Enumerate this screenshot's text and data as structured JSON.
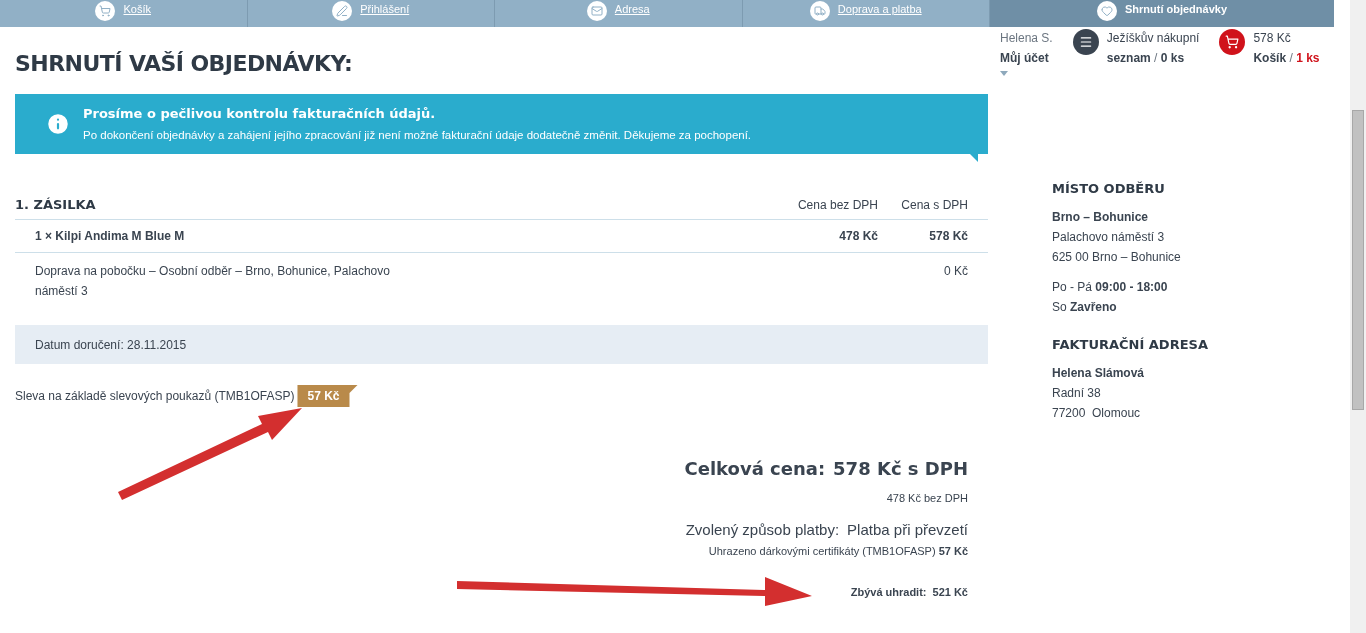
{
  "steps": [
    {
      "label": "Košík",
      "selected": false
    },
    {
      "label": "Přihlášení",
      "selected": false
    },
    {
      "label": "Adresa",
      "selected": false
    },
    {
      "label": "Doprava a platba",
      "selected": false
    },
    {
      "label": "Shrnutí objednávky",
      "selected": true
    }
  ],
  "user": {
    "name": "Helena S.",
    "account": "Můj účet"
  },
  "wishlist": {
    "line1": "Ježíškův nákupní",
    "label": "seznam",
    "separator": "/",
    "count": "0 ks"
  },
  "cart": {
    "price": "578 Kč",
    "label": "Košík",
    "separator": "/",
    "count": "1 ks"
  },
  "title": "SHRNUTÍ VAŠÍ OBJEDNÁVKY:",
  "notice": {
    "heading": "Prosíme o pečlivou kontrolu fakturačních údajů.",
    "text": "Po dokončení objednávky a zahájení jejího zpracování již není možné fakturační údaje dodatečně změnit. Děkujeme za pochopení."
  },
  "shipment": {
    "title": "1. ZÁSILKA",
    "columns": [
      "Cena bez DPH",
      "Cena s DPH"
    ],
    "rows": [
      {
        "kind": "product",
        "label": "1 × Kilpi Andima M Blue M",
        "price_net": "478 Kč",
        "price_gross": "578 Kč"
      },
      {
        "kind": "shipping",
        "label": "Doprava na pobočku – Osobní odběr – Brno, Bohunice, Palachovo náměstí 3",
        "price_gross": "0 Kč"
      }
    ],
    "delivery_date": "Datum doručení: 28.11.2015"
  },
  "discount": {
    "label": "Sleva na základě slevových poukazů (TMB1OFASP)",
    "amount": "57 Kč"
  },
  "totals": {
    "total_label": "Celková cena:",
    "total": "578 Kč s DPH",
    "net": "478 Kč bez DPH",
    "payment_label": "Zvolený způsob platby:",
    "payment": "Platba při převzetí",
    "certificates": "Uhrazeno dárkovými certifikáty (TMB1OFASP) **57 Kč**",
    "remaining_label": "Zbývá uhradit:",
    "remaining": "521 Kč"
  },
  "pickup": {
    "title": "MÍSTO ODBĚRU",
    "name": "Brno – Bohunice",
    "lines": [
      "Palachovo náměstí 3",
      "625 00 Brno – Bohunice"
    ],
    "hours": [
      "Po - Pá **09:00 - 18:00**",
      "So **Zavřeno**"
    ]
  },
  "billing": {
    "title": "FAKTURAČNÍ ADRESA",
    "name": "Helena Slámová",
    "lines": [
      "Radní 38",
      "77200  Olomouc"
    ]
  }
}
